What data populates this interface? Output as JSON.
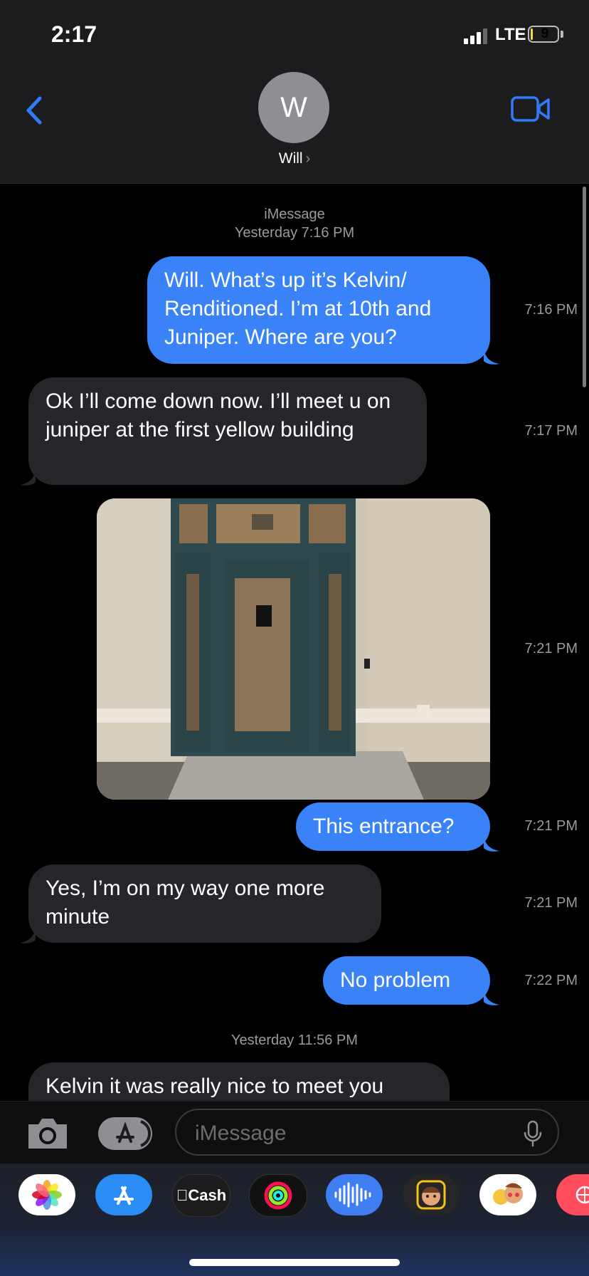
{
  "status": {
    "time": "2:17",
    "network": "LTE",
    "battery": "9",
    "battery_level": 0.09
  },
  "header": {
    "avatar_initial": "W",
    "contact_name": "Will",
    "chevron": "›"
  },
  "conversation": {
    "service_label": "iMessage",
    "day_label_1": "Yesterday 7:16 PM",
    "day_label_2": "Yesterday 11:56 PM",
    "messages": [
      {
        "direction": "outgoing",
        "text": "Will. What’s up it’s Kelvin/ Renditioned. I’m at 10th and Juniper. Where are you?",
        "time": "7:16 PM"
      },
      {
        "direction": "incoming",
        "text": "Ok I’ll come down now. I’ll meet u on juniper at the first yellow building",
        "time": "7:17 PM"
      },
      {
        "direction": "outgoing",
        "type": "photo",
        "time": "7:21 PM"
      },
      {
        "direction": "outgoing",
        "text": "This entrance?",
        "time": "7:21 PM"
      },
      {
        "direction": "incoming",
        "text": "Yes, I’m on my way one more minute",
        "time": "7:21 PM"
      },
      {
        "direction": "outgoing",
        "text": "No problem",
        "time": "7:22 PM"
      },
      {
        "direction": "incoming",
        "text": "Kelvin it was really nice to meet you",
        "time": ""
      }
    ]
  },
  "composer": {
    "placeholder": "iMessage"
  },
  "app_tray": {
    "apps": [
      "photos-icon",
      "app-store-icon",
      "apple-cash-icon",
      "activity-icon",
      "audio-message-icon",
      "memoji-icon",
      "animoji-icon",
      "web-search-icon"
    ],
    "cash_label": "Cash"
  },
  "colors": {
    "outgoing": "#3a82f7",
    "incoming": "#26252a",
    "accent": "#2f7cf6"
  }
}
